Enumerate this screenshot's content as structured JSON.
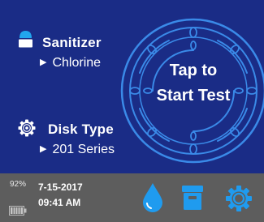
{
  "sanitizer": {
    "title": "Sanitizer",
    "value": "Chlorine",
    "icon": "sanitizer-bottle-icon"
  },
  "disk": {
    "title": "Disk Type",
    "value": "201 Series",
    "icon": "disk-gear-icon"
  },
  "start_button": {
    "line1": "Tap to",
    "line2": "Start Test"
  },
  "status": {
    "battery_percent": "92%",
    "date": "7-15-2017",
    "time": "09:41 AM"
  },
  "toolbar": {
    "water_icon": "water-drop-icon",
    "storage_icon": "storage-box-icon",
    "settings_icon": "gear-settings-icon"
  },
  "colors": {
    "background": "#1a2c86",
    "accent": "#1e90ff",
    "status_bar": "#5d5d5d",
    "text": "#ffffff"
  },
  "arrow_glyph": "▶"
}
